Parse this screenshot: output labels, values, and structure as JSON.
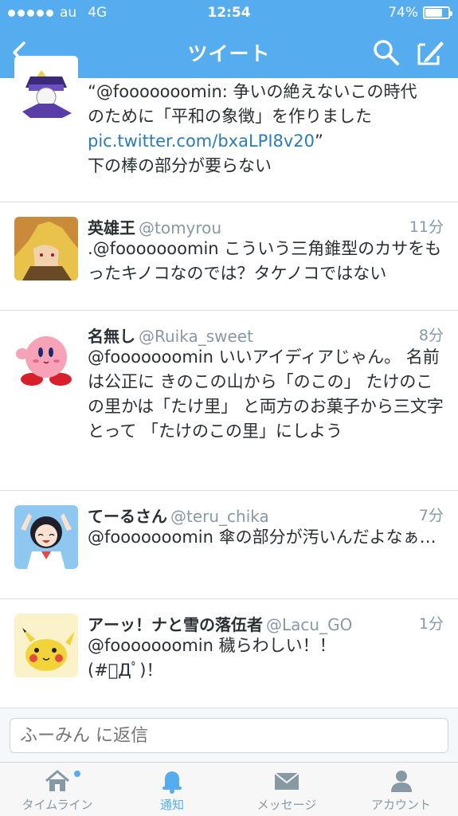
{
  "status_bar": {
    "carrier": "au",
    "network": "4G",
    "time": "12:54",
    "battery": "74%",
    "battery_level": 0.74
  },
  "nav": {
    "title": "ツイート",
    "back_icon": "chevron-left-icon",
    "search_icon": "search-icon",
    "compose_icon": "compose-icon"
  },
  "tweets": [
    {
      "avatar": "jotaro-cartoon-avatar",
      "body_line1": "“@fooooooomin: 争いの絶えないこの時代",
      "body_line2": "のために「平和の象徴」を作りました",
      "link": "pic.twitter.com/bxaLPI8v20",
      "link_suffix": "”",
      "body_line4": "下の棒の部分が要らない"
    },
    {
      "name": "英雄王",
      "handle": "@tomyrou",
      "time": "11分",
      "avatar": "gilgamesh-avatar",
      "text": ".@fooooooomin こういう三角錐型のカサをもったキノコなのでは？タケノコではない"
    },
    {
      "name": "名無し",
      "handle": "@Ruika_sweet",
      "time": "8分",
      "avatar": "kirby-avatar",
      "text": "@fooooooomin いいアイディアじゃん。 名前は公正に きのこの山から「のこの」 たけのこの里かは「たけ里」 と両方のお菓子から三文字とって 「たけのこの里」にしよう"
    },
    {
      "name": "てーるさん",
      "handle": "@teru_chika",
      "time": "7分",
      "avatar": "anime-girl-avatar",
      "text": "@fooooooomin 傘の部分が汚いんだよなぁ…"
    },
    {
      "name": "アーッ！ナと雪の落伍者",
      "handle": "@Lacu_GO",
      "time": "1分",
      "avatar": "pikachu-avatar",
      "text_line1": "@fooooooomin 穢らわしい！！",
      "text_line2": "(#ﾟДﾟ)！"
    }
  ],
  "reply": {
    "placeholder": "ふーみん に返信"
  },
  "tabbar": {
    "items": [
      {
        "label": "タイムライン",
        "icon": "home-icon",
        "has_dot": true
      },
      {
        "label": "通知",
        "icon": "bell-icon",
        "active": true
      },
      {
        "label": "メッセージ",
        "icon": "envelope-icon"
      },
      {
        "label": "アカウント",
        "icon": "person-icon"
      }
    ]
  },
  "colors": {
    "brand": "#55acee",
    "link": "#2b7bb9",
    "secondary_text": "#8899a6"
  }
}
